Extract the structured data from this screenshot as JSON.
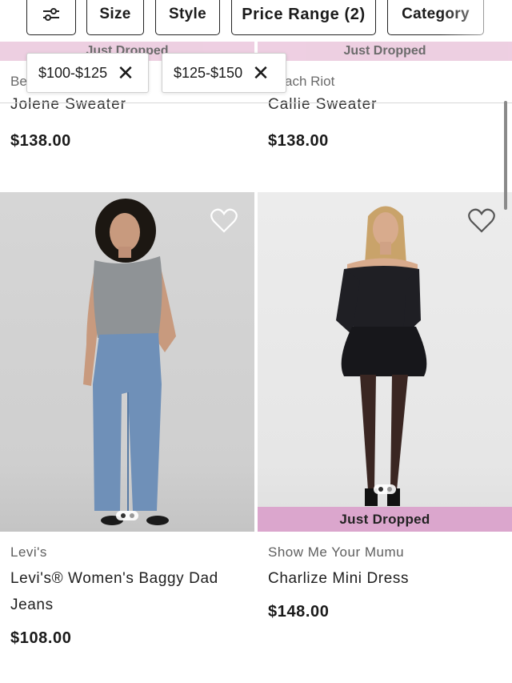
{
  "filters": {
    "filter_icon": "sliders-icon",
    "size": "Size",
    "style": "Style",
    "price_range": "Price Range (2)",
    "category": "Category"
  },
  "active_chips": [
    {
      "label": "$100-$125",
      "remove": "✕"
    },
    {
      "label": "$125-$150",
      "remove": "✕"
    }
  ],
  "top_row": {
    "left": {
      "badge": "Just Dropped",
      "brand": "Be",
      "name": "Jolene Sweater",
      "price": "$138.00"
    },
    "right": {
      "badge": "Just Dropped",
      "brand": "ach Riot",
      "name": "Callie Sweater",
      "price": "$138.00"
    }
  },
  "products": [
    {
      "brand": "Levi's",
      "name_line1": "Levi's® Women's Baggy Dad",
      "name_line2": "Jeans",
      "price": "$108.00",
      "badge": ""
    },
    {
      "brand": "Show Me Your Mumu",
      "name_line1": "Charlize Mini Dress",
      "name_line2": "",
      "price": "$148.00",
      "badge": "Just Dropped"
    }
  ],
  "colors": {
    "badge_pink": "#dba6cd",
    "text": "#1a1a1a"
  }
}
